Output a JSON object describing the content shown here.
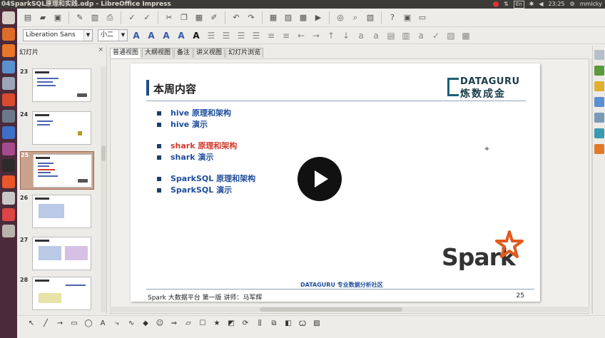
{
  "window": {
    "title": "04SparkSQL原理和实践.odp - LibreOffice Impress"
  },
  "tray": {
    "keyboard": "En",
    "time": "23:25",
    "user": "mmicky"
  },
  "toolbar2": {
    "font_name": "Liberation Sans",
    "font_size": "小二"
  },
  "slide_panel": {
    "title": "幻灯片",
    "close": "×",
    "thumbnails": [
      {
        "number": "23"
      },
      {
        "number": "24"
      },
      {
        "number": "25"
      },
      {
        "number": "26"
      },
      {
        "number": "27"
      },
      {
        "number": "28"
      }
    ]
  },
  "view_tabs": [
    "普通视图",
    "大纲视图",
    "备注",
    "讲义视图",
    "幻灯片浏览"
  ],
  "slide": {
    "title": "本周内容",
    "logo_line1": "DATAGURU",
    "logo_line2": "炼数成金",
    "bullets": [
      "hive 原理和架构",
      "hive 演示",
      "shark 原理和架构",
      "shark 演示",
      "SparkSQL 原理和架构",
      "SparkSQL 演示"
    ],
    "spark_logo_text": "Spark",
    "community": "DATAGURU 专业数据分析社区",
    "footer": "Spark 大数据平台 第一版 讲师：马军辉",
    "page_number": "25"
  },
  "colors": {
    "accent_blue": "#1f4d9b",
    "highlight_red": "#d43a2c",
    "spark_orange": "#e25a1c",
    "launcher": "#4b2b3a"
  }
}
